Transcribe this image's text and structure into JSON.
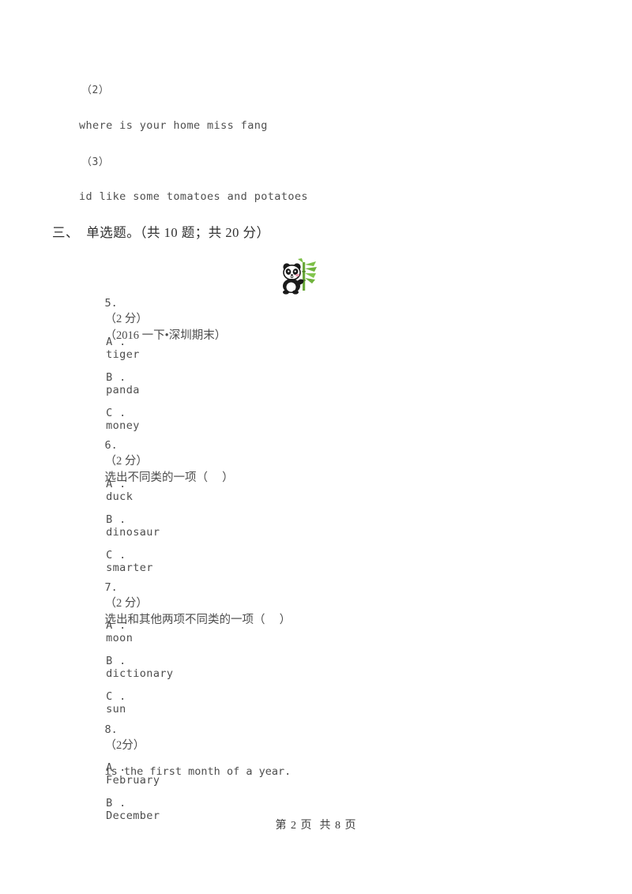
{
  "document": {
    "page_footer": "第 2 页  共 8 页"
  },
  "continued_section": {
    "items": [
      {
        "label": "（2）",
        "text": "where is your home miss fang"
      },
      {
        "label": "（3）",
        "text": "id like some tomatoes and potatoes"
      }
    ]
  },
  "section": {
    "heading": "三、  单选题。（共 10 题；共 20 分）"
  },
  "questions": [
    {
      "number": "5.",
      "points": "（2 分）",
      "source": "（2016 一下•深圳期末）",
      "prompt": "",
      "image": "panda-illustration",
      "options": [
        {
          "letter": "A .",
          "text": "tiger"
        },
        {
          "letter": "B .",
          "text": "panda"
        },
        {
          "letter": "C .",
          "text": "money"
        }
      ]
    },
    {
      "number": "6.",
      "points": "（2 分）",
      "prompt": "选出不同类的一项（     ）",
      "options": [
        {
          "letter": "A .",
          "text": "duck"
        },
        {
          "letter": "B .",
          "text": "dinosaur"
        },
        {
          "letter": "C .",
          "text": "smarter"
        }
      ]
    },
    {
      "number": "7.",
      "points": "（2 分）",
      "prompt": "选出和其他两项不同类的一项（     ）",
      "options": [
        {
          "letter": "A .",
          "text": "moon"
        },
        {
          "letter": "B .",
          "text": "dictionary"
        },
        {
          "letter": "C .",
          "text": "sun"
        }
      ]
    },
    {
      "number": "8.",
      "points": "（2分）",
      "prompt_after_blank": "is the first month of a year.",
      "options": [
        {
          "letter": "A .",
          "text": "February"
        },
        {
          "letter": "B .",
          "text": "December"
        }
      ]
    }
  ],
  "colors": {
    "page_background": "#ffffff",
    "text": "#4f4f4f",
    "heading_text": "#2f2f2f",
    "panda_body": "#1a1a1a",
    "panda_face": "#ffffff",
    "panda_cheek": "#f2a0b4",
    "bamboo_green": "#5aa72e"
  }
}
